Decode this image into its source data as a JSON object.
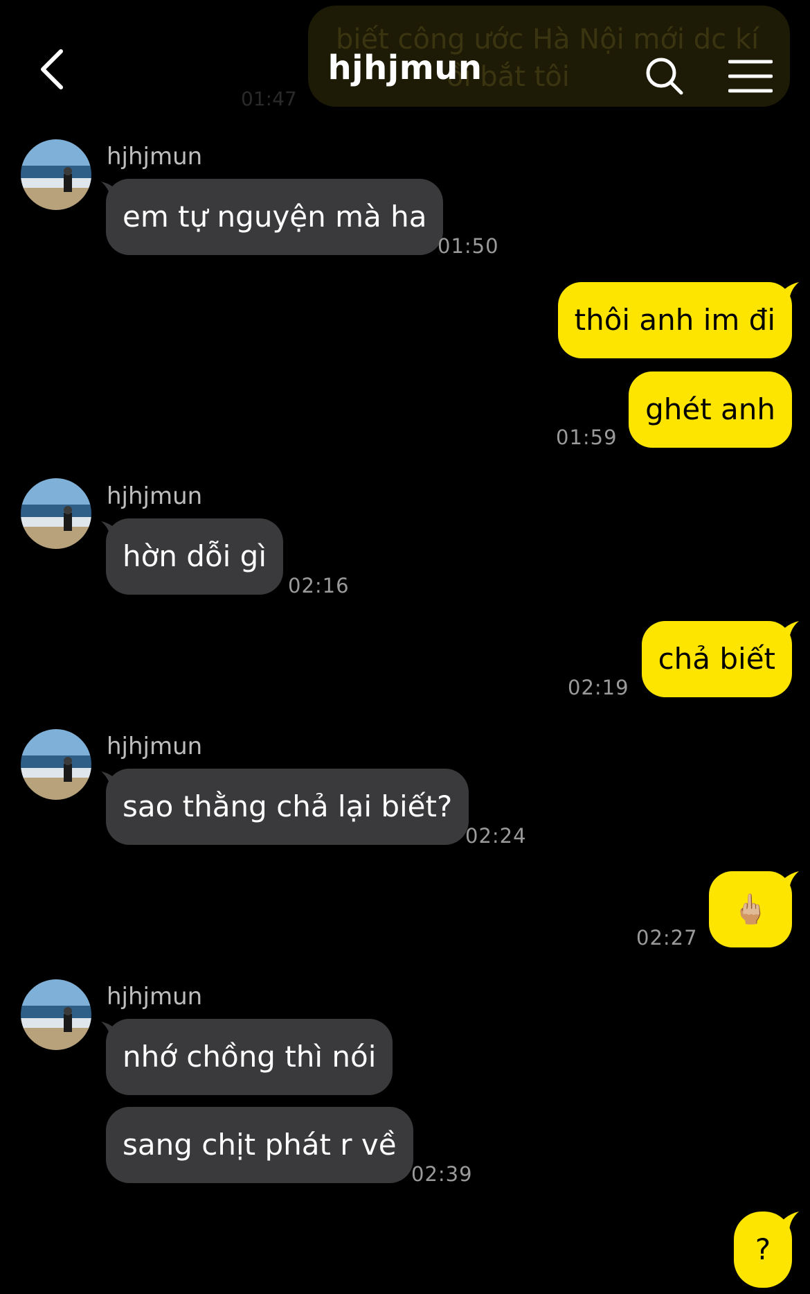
{
  "header": {
    "title": "hjhjmun",
    "back_icon": "chevron-left-icon",
    "search_icon": "search-icon",
    "menu_icon": "menu-icon"
  },
  "partial_message": {
    "text": "biết công ước Hà Nội mới dc kí",
    "text_line2": "ồi bắt tôi",
    "time": "01:47"
  },
  "messages": [
    {
      "direction": "in",
      "sender": "hjhjmun",
      "text": "em tự nguyện mà ha",
      "time": "01:50"
    },
    {
      "direction": "out",
      "text": "thôi anh im đi"
    },
    {
      "direction": "out",
      "text": "ghét anh",
      "time": "01:59"
    },
    {
      "direction": "in",
      "sender": "hjhjmun",
      "text": "hờn dỗi gì",
      "time": "02:16"
    },
    {
      "direction": "out",
      "text": "chả biết",
      "time": "02:19"
    },
    {
      "direction": "in",
      "sender": "hjhjmun",
      "text": "sao thằng chả lại biết?",
      "time": "02:24"
    },
    {
      "direction": "out",
      "text": "🖕🏼",
      "time": "02:27"
    },
    {
      "direction": "in",
      "sender": "hjhjmun",
      "text": "nhớ chồng thì nói"
    },
    {
      "direction": "in",
      "text": "sang chịt phát r về",
      "time": "02:39"
    },
    {
      "direction": "out",
      "text": "?"
    }
  ],
  "colors": {
    "background": "#000000",
    "incoming_bubble": "#3a3a3c",
    "outgoing_bubble": "#fde500",
    "timestamp": "#9a9a9a",
    "sender_name": "#bdbdbd"
  }
}
